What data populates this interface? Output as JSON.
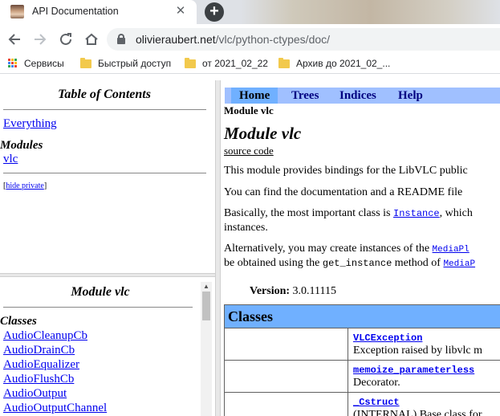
{
  "browser": {
    "tab_title": "API Documentation",
    "tab_close": "✕",
    "new_tab": "+",
    "url_host": "olivieraubert.net",
    "url_path": "/vlc/python-ctypes/doc/",
    "icons": {
      "back": "back-arrow-icon",
      "forward": "forward-arrow-icon",
      "reload": "reload-icon",
      "home": "home-icon",
      "lock": "lock-icon",
      "apps": "apps-grid-icon",
      "folder": "folder-icon"
    },
    "bookmarks": [
      {
        "label": "Сервисы",
        "icon": "apps-grid-icon"
      },
      {
        "label": "Быстрый доступ",
        "icon": "folder-icon"
      },
      {
        "label": "от 2021_02_22",
        "icon": "folder-icon"
      },
      {
        "label": "Архив до 2021_02_...",
        "icon": "folder-icon"
      }
    ],
    "folder_color": "#f2c94c"
  },
  "toc": {
    "heading": "Table of Contents",
    "everything": "Everything",
    "modules_heading": "Modules",
    "module_link": "vlc",
    "hide_private": "hide private",
    "bracket_open": "[",
    "bracket_close": "]"
  },
  "module_frame": {
    "heading": "Module vlc",
    "classes_heading": "Classes",
    "classes": [
      "AudioCleanupCb",
      "AudioDrainCb",
      "AudioEqualizer",
      "AudioFlushCb",
      "AudioOutput",
      "AudioOutputChannel"
    ]
  },
  "main": {
    "nav": [
      "Home",
      "Trees",
      "Indices",
      "Help"
    ],
    "nav_active": "Home",
    "breadcrumb": "Module vlc",
    "title": "Module vlc",
    "source_code": "source code",
    "p1": "This module provides bindings for the LibVLC public",
    "p2": "You can find the documentation and a README file",
    "p3_a": "Basically, the most important class is ",
    "p3_link": "Instance",
    "p3_b": ", which",
    "p3_c": "instances.",
    "p4_a": "Alternatively, you may create instances of the ",
    "p4_link": "MediaPl",
    "p5_a": "be obtained using the ",
    "p5_code": "get_instance",
    "p5_b": " method of ",
    "p5_link": "MediaP",
    "version_label": "Version:",
    "version_value": "3.0.11115",
    "classes_heading": "Classes",
    "class_rows": [
      {
        "name": "VLCException",
        "desc": "Exception raised by libvlc m"
      },
      {
        "name": "memoize_parameterless",
        "desc": "Decorator."
      },
      {
        "name": "_Cstruct",
        "desc": "(INTERNAL) Base class for"
      }
    ],
    "colors": {
      "navbar": "#a0c0ff",
      "nav_active": "#70b0ff",
      "table_header": "#70b0ff",
      "link": "#0000ee"
    }
  }
}
